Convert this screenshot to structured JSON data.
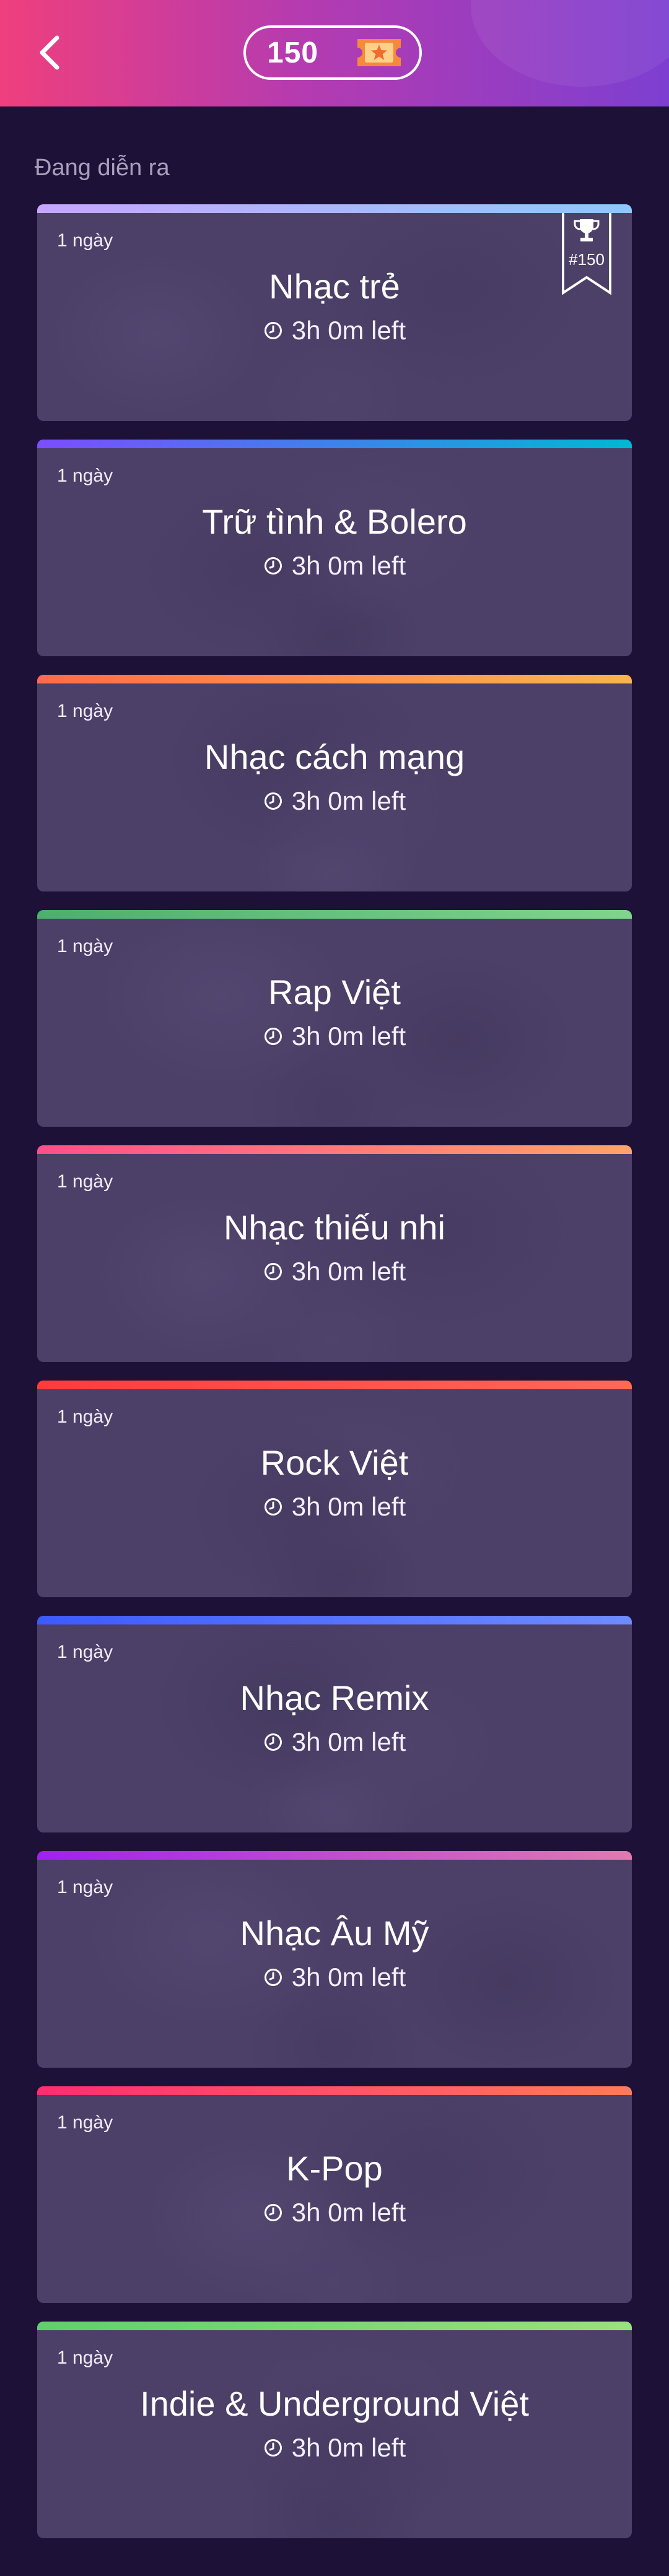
{
  "header": {
    "points": "150",
    "ticket_icon": "ticket-star-icon",
    "back_icon": "chevron-left-icon"
  },
  "section_label": "Đang diễn ra",
  "cards": [
    {
      "duration": "1 ngày",
      "title": "Nhạc trẻ",
      "time_left": "3h 0m left",
      "rank": "#150",
      "stripe": [
        "#c6a6ff",
        "#8fc7ff"
      ]
    },
    {
      "duration": "1 ngày",
      "title": "Trữ tình & Bolero",
      "time_left": "3h 0m left",
      "stripe": [
        "#7c4dff",
        "#00b8d4"
      ]
    },
    {
      "duration": "1 ngày",
      "title": "Nhạc cách mạng",
      "time_left": "3h 0m left",
      "stripe": [
        "#ff6b4a",
        "#f9b54a"
      ]
    },
    {
      "duration": "1 ngày",
      "title": "Rap Việt",
      "time_left": "3h 0m left",
      "stripe": [
        "#4caf6e",
        "#7ed68a"
      ]
    },
    {
      "duration": "1 ngày",
      "title": "Nhạc thiếu nhi",
      "time_left": "3h 0m left",
      "stripe": [
        "#ff4f8a",
        "#ffa36b"
      ]
    },
    {
      "duration": "1 ngày",
      "title": "Rock Việt",
      "time_left": "3h 0m left",
      "stripe": [
        "#ff3b3b",
        "#ff6a55"
      ]
    },
    {
      "duration": "1 ngày",
      "title": "Nhạc Remix",
      "time_left": "3h 0m left",
      "stripe": [
        "#3d5afe",
        "#6e8bff"
      ]
    },
    {
      "duration": "1 ngày",
      "title": "Nhạc Âu Mỹ",
      "time_left": "3h 0m left",
      "stripe": [
        "#a020f0",
        "#e07ab0"
      ]
    },
    {
      "duration": "1 ngày",
      "title": "K-Pop",
      "time_left": "3h 0m left",
      "stripe": [
        "#ff2d6f",
        "#ff7a5c"
      ]
    },
    {
      "duration": "1 ngày",
      "title": "Indie & Underground Việt",
      "time_left": "3h 0m left",
      "stripe": [
        "#5ed16a",
        "#9be07c"
      ]
    }
  ],
  "colors": {
    "background": "#1e1137",
    "card": "#4c4068",
    "header_start": "#ef3f7d",
    "header_end": "#7d3fd1",
    "ticket_orange": "#f58a3a"
  }
}
